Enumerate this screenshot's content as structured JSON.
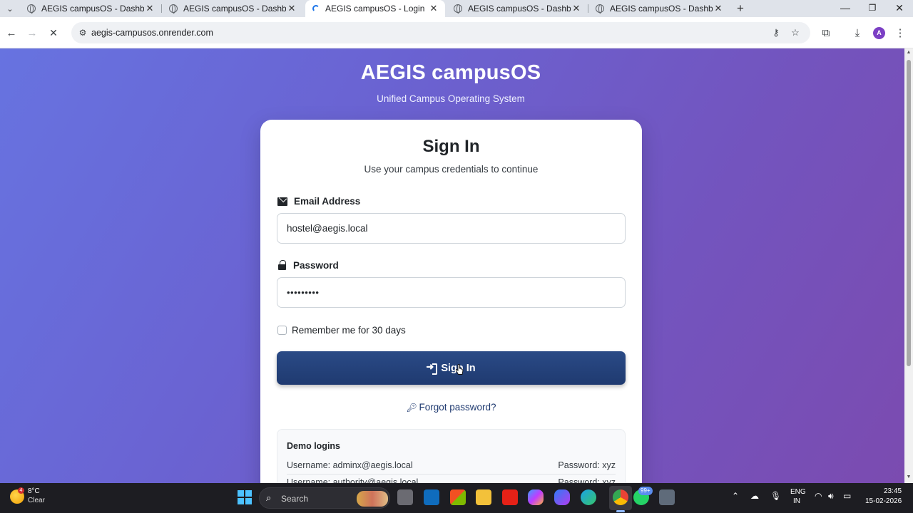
{
  "browser": {
    "tabs": [
      {
        "title": "AEGIS campusOS - Dashboard",
        "active": false
      },
      {
        "title": "AEGIS campusOS - Dashboard",
        "active": false
      },
      {
        "title": "AEGIS campusOS - Login",
        "active": true
      },
      {
        "title": "AEGIS campusOS - Dashboard",
        "active": false
      },
      {
        "title": "AEGIS campusOS - Dashboard",
        "active": false
      }
    ],
    "close_glyph": "✕",
    "new_tab_glyph": "+",
    "url": "aegis-campusos.onrender.com",
    "profile_initial": "A"
  },
  "page": {
    "brand": "AEGIS campusOS",
    "tagline": "Unified Campus Operating System",
    "card": {
      "title": "Sign In",
      "subtitle": "Use your campus credentials to continue",
      "email_label": "Email Address",
      "email_value": "hostel@aegis.local",
      "password_label": "Password",
      "password_value": "•••••••••",
      "remember_label": "Remember me for 30 days",
      "remember_checked": false,
      "signin_label": "Sign In",
      "forgot_label": "Forgot password?",
      "demo": {
        "title": "Demo logins",
        "rows": [
          {
            "username": "Username: adminx@aegis.local",
            "password": "Password: xyz"
          },
          {
            "username": "Username: authority@aegis.local",
            "password": "Password: xyz"
          }
        ]
      }
    },
    "colors": {
      "accent": "#1f3a70",
      "background_start": "#6773e0",
      "background_end": "#7b4bb0"
    }
  },
  "taskbar": {
    "weather_temp": "8°C",
    "weather_desc": "Clear",
    "weather_badge": "4",
    "search_placeholder": "Search",
    "chat_badge": "99+",
    "lang_line1": "ENG",
    "lang_line2": "IN",
    "time": "23:45",
    "date": "15-02-2026"
  }
}
